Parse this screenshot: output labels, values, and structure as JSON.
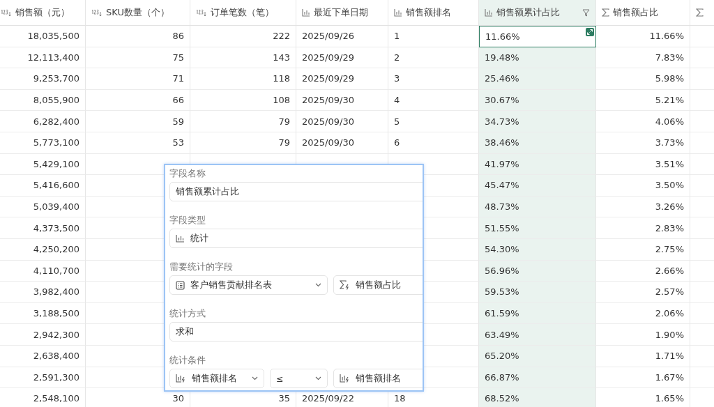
{
  "table": {
    "columns": [
      {
        "label": "销售额（元）",
        "kind": "number",
        "highlighted": false,
        "filter": false
      },
      {
        "label": "SKU数量（个）",
        "kind": "number",
        "highlighted": false,
        "filter": false
      },
      {
        "label": "订单笔数（笔）",
        "kind": "number",
        "highlighted": false,
        "filter": false
      },
      {
        "label": "最近下单日期",
        "kind": "stat",
        "highlighted": false,
        "filter": false
      },
      {
        "label": "销售额排名",
        "kind": "stat",
        "highlighted": false,
        "filter": false
      },
      {
        "label": "销售额累计占比",
        "kind": "stat",
        "highlighted": true,
        "filter": true
      },
      {
        "label": "销售额占比",
        "kind": "sigma",
        "highlighted": false,
        "filter": false
      },
      {
        "kind": "sigma",
        "highlighted": false,
        "filter": false
      }
    ],
    "rows": [
      {
        "active": true,
        "cells": [
          "18,035,500",
          "86",
          "222",
          "2025/09/26",
          "1",
          "11.66%",
          "11.66%"
        ]
      },
      {
        "active": false,
        "cells": [
          "12,113,400",
          "75",
          "143",
          "2025/09/29",
          "2",
          "19.48%",
          "7.83%"
        ]
      },
      {
        "active": false,
        "cells": [
          "9,253,700",
          "71",
          "118",
          "2025/09/29",
          "3",
          "25.46%",
          "5.98%"
        ]
      },
      {
        "active": false,
        "cells": [
          "8,055,900",
          "66",
          "108",
          "2025/09/30",
          "4",
          "30.67%",
          "5.21%"
        ]
      },
      {
        "active": false,
        "cells": [
          "6,282,400",
          "59",
          "79",
          "2025/09/30",
          "5",
          "34.73%",
          "4.06%"
        ]
      },
      {
        "active": false,
        "cells": [
          "5,773,100",
          "53",
          "79",
          "2025/09/30",
          "6",
          "38.46%",
          "3.73%"
        ]
      },
      {
        "active": false,
        "cells": [
          "5,429,100",
          null,
          null,
          null,
          null,
          "41.97%",
          "3.51%"
        ]
      },
      {
        "active": false,
        "cells": [
          "5,416,600",
          null,
          null,
          null,
          null,
          "45.47%",
          "3.50%"
        ]
      },
      {
        "active": false,
        "cells": [
          "5,039,400",
          null,
          null,
          null,
          null,
          "48.73%",
          "3.26%"
        ]
      },
      {
        "active": false,
        "cells": [
          "4,373,500",
          null,
          null,
          null,
          null,
          "51.55%",
          "2.83%"
        ]
      },
      {
        "active": false,
        "cells": [
          "4,250,200",
          null,
          null,
          null,
          null,
          "54.30%",
          "2.75%"
        ]
      },
      {
        "active": false,
        "cells": [
          "4,110,700",
          null,
          null,
          null,
          null,
          "56.96%",
          "2.66%"
        ]
      },
      {
        "active": false,
        "cells": [
          "3,982,400",
          null,
          null,
          null,
          null,
          "59.53%",
          "2.57%"
        ]
      },
      {
        "active": false,
        "cells": [
          "3,188,500",
          null,
          null,
          null,
          null,
          "61.59%",
          "2.06%"
        ]
      },
      {
        "active": false,
        "cells": [
          "2,942,300",
          null,
          null,
          null,
          null,
          "63.49%",
          "1.90%"
        ]
      },
      {
        "active": false,
        "cells": [
          "2,638,400",
          null,
          null,
          null,
          null,
          "65.20%",
          "1.71%"
        ]
      },
      {
        "active": false,
        "cells": [
          "2,591,300",
          null,
          null,
          null,
          null,
          "66.87%",
          "1.67%"
        ]
      },
      {
        "active": false,
        "cells": [
          "2,548,100",
          "30",
          "35",
          "2025/09/22",
          "18",
          "68.52%",
          "1.65%"
        ]
      }
    ]
  },
  "field_editor": {
    "sections": [
      {
        "label": "字段名称",
        "kind": "text",
        "value": "销售额累计占比"
      },
      {
        "label": "字段类型",
        "kind": "type",
        "value": "统计"
      },
      {
        "label": "需要统计的字段",
        "kind": "lookup",
        "table": "客户销售贡献排名表",
        "field": "销售额占比"
      },
      {
        "label": "统计方式",
        "kind": "text",
        "value": "求和"
      },
      {
        "label": "统计条件",
        "kind": "condition",
        "field": "销售额排名",
        "operator": "≤",
        "value": "销售额排名"
      }
    ]
  }
}
